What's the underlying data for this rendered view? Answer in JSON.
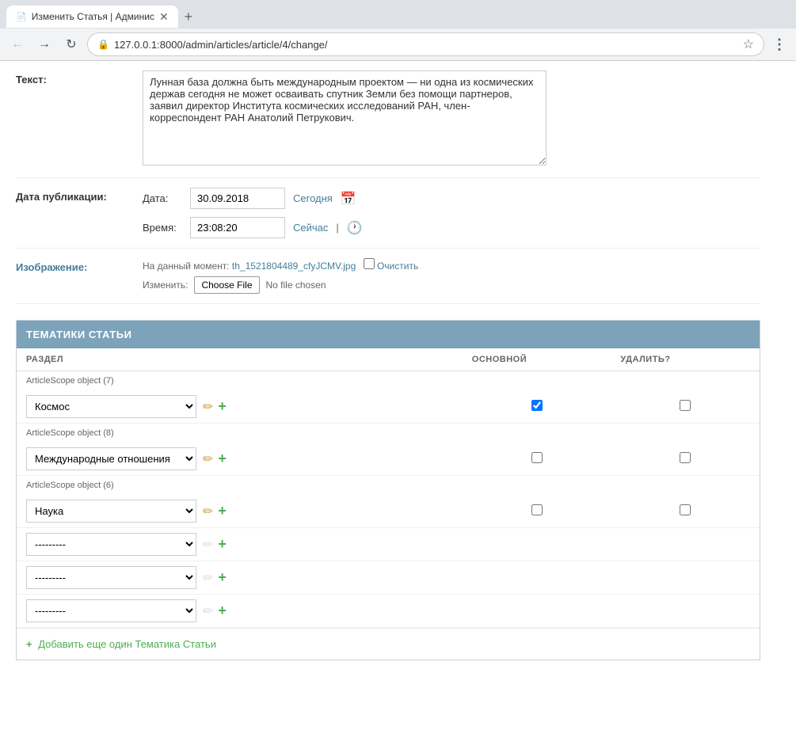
{
  "browser": {
    "tab_title": "Изменить Статья | Админис",
    "tab_icon": "📄",
    "url": "127.0.0.1:8000/admin/articles/article/4/change/",
    "url_prefix": "127.0.0.1:8000/admin/articles/article/4/change/"
  },
  "form": {
    "text_label": "Текст:",
    "text_value": "Лунная база должна быть международным проектом — ни одна из космических держав сегодня не может осваивать спутник Земли без помощи партнеров, заявил директор Института космических исследований РАН, член-корреспондент РАН Анатолий Петрукович.",
    "pub_date_label": "Дата публикации:",
    "date_label": "Дата:",
    "date_value": "30.09.2018",
    "today_label": "Сегодня",
    "time_label": "Время:",
    "time_value": "23:08:20",
    "now_label": "Сейчас",
    "image_label": "Изображение:",
    "current_file_prefix": "На данный момент:",
    "current_file_name": "th_1521804489_cfyJCMV.jpg",
    "clear_label": "Очистить",
    "change_label": "Изменить:",
    "choose_file_label": "Choose File",
    "no_file_label": "No file chosen"
  },
  "inline": {
    "section_title": "ТЕМАТИКИ СТАТЬИ",
    "col_section": "РАЗДЕЛ",
    "col_main": "ОСНОВНОЙ",
    "col_delete": "УДАЛИТЬ?",
    "rows": [
      {
        "id": 7,
        "object_label": "ArticleScope object (7)",
        "select_value": "Космос",
        "is_main": true,
        "is_delete": false,
        "has_edit": true
      },
      {
        "id": 8,
        "object_label": "ArticleScope object (8)",
        "select_value": "Международные отношения",
        "is_main": false,
        "is_delete": false,
        "has_edit": true
      },
      {
        "id": 6,
        "object_label": "ArticleScope object (6)",
        "select_value": "Наука",
        "is_main": false,
        "is_delete": false,
        "has_edit": true
      },
      {
        "id": "new1",
        "object_label": "",
        "select_value": "---------",
        "is_main": false,
        "is_delete": null,
        "has_edit": false
      },
      {
        "id": "new2",
        "object_label": "",
        "select_value": "---------",
        "is_main": false,
        "is_delete": null,
        "has_edit": false
      },
      {
        "id": "new3",
        "object_label": "",
        "select_value": "---------",
        "is_main": false,
        "is_delete": null,
        "has_edit": false
      }
    ],
    "add_another_label": "Добавить еще один Тематика Статьи"
  }
}
